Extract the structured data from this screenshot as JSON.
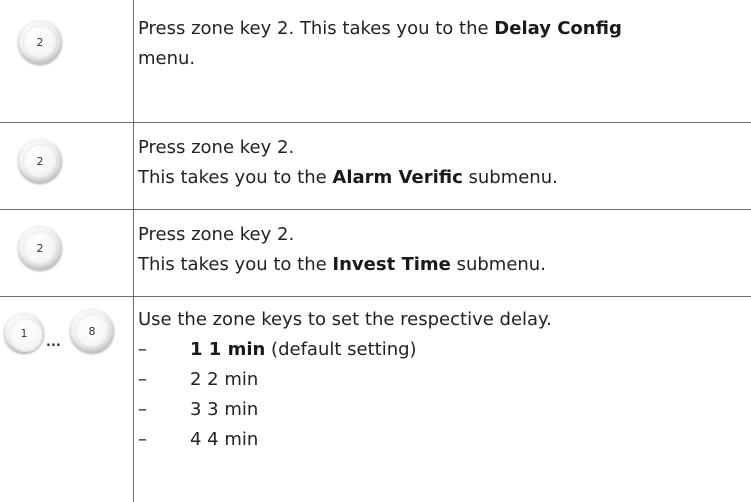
{
  "steps": [
    {
      "keys": [
        "2"
      ],
      "lines": [
        {
          "before": "Press zone key 2. This takes you to the ",
          "bold": "Delay Config",
          "after": ""
        },
        {
          "before": "menu.",
          "bold": "",
          "after": ""
        }
      ]
    },
    {
      "keys": [
        "2"
      ],
      "lines": [
        {
          "before": "Press zone key 2.",
          "bold": "",
          "after": ""
        },
        {
          "before": "This takes you to the ",
          "bold": "Alarm Verific",
          "after": " submenu."
        }
      ]
    },
    {
      "keys": [
        "2"
      ],
      "lines": [
        {
          "before": "Press zone key 2.",
          "bold": "",
          "after": ""
        },
        {
          "before": "This takes you to the ",
          "bold": "Invest Time",
          "after": " submenu."
        }
      ]
    },
    {
      "keys": [
        "1",
        "8"
      ],
      "ellipsis": "...",
      "intro": "Use the zone keys to set the respective delay.",
      "options": [
        {
          "dash": "–",
          "bold": "1 1 min",
          "text": " (default setting)"
        },
        {
          "dash": "–",
          "bold": "",
          "text": "2 2 min"
        },
        {
          "dash": "–",
          "bold": "",
          "text": "3 3 min"
        },
        {
          "dash": "–",
          "bold": "",
          "text": "4 4 min"
        }
      ]
    }
  ]
}
